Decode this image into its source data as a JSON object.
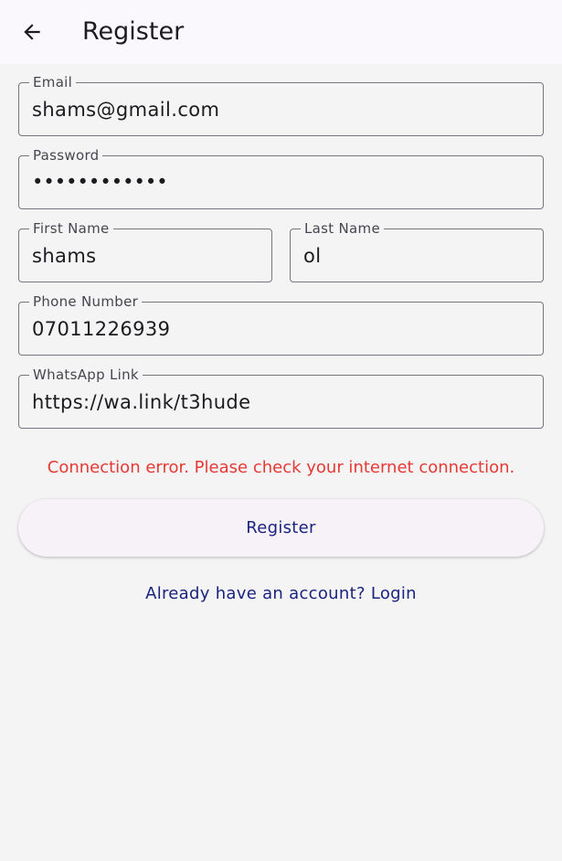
{
  "appbar": {
    "title": "Register",
    "back_icon": "arrow-left-icon"
  },
  "form": {
    "email": {
      "label": "Email",
      "value": "shams@gmail.com"
    },
    "password": {
      "label": "Password",
      "value": "••••••••••••"
    },
    "first_name": {
      "label": "First Name",
      "value": "shams"
    },
    "last_name": {
      "label": "Last Name",
      "value": "ol"
    },
    "phone": {
      "label": "Phone Number",
      "value": "07011226939"
    },
    "whatsapp": {
      "label": "WhatsApp Link",
      "value": "https://wa.link/t3hude"
    }
  },
  "error_message": "Connection error. Please check your internet connection.",
  "register_button": "Register",
  "login_link": "Already have an account? Login",
  "colors": {
    "error": "#e53935",
    "primary_text": "#1a237e",
    "appbar_bg": "#fbf8fd",
    "page_bg": "#f4f4f4",
    "outline": "#79747e"
  }
}
